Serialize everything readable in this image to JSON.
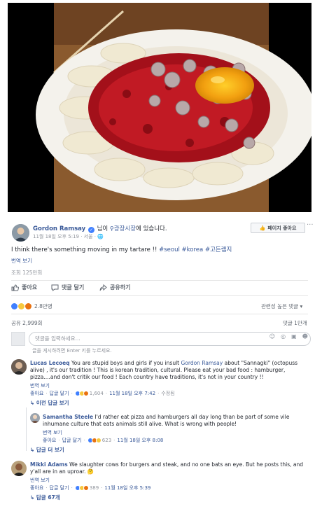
{
  "post": {
    "author": "Gordon Ramsay",
    "author_suffix": "님이",
    "location": "광장시장",
    "location_suffix": "에 있습니다.",
    "meta": "11월 18일 오후 5:19 · 서울 ·",
    "like_page_label": "페이지 좋아요",
    "more_label": "···",
    "caption_text": "I think there's something moving in my tartare !! ",
    "caption_tags": "#seoul #korea #고든램지",
    "see_translation": "번역 보기",
    "views": "조회 125만회"
  },
  "actions": {
    "like": "좋아요",
    "comment": "댓글 달기",
    "share": "공유하기"
  },
  "stats": {
    "reactions": "2.8만명",
    "ranking": "관련성 높은 댓글 ▾",
    "shares": "공유 2,999회",
    "comment_count": "댓글 1만개"
  },
  "composer": {
    "placeholder": "댓글을 입력하세요...",
    "hint": "글을 게시하려면 Enter 키를 누르세요."
  },
  "comments": [
    {
      "author": "Lucas Lecoeq",
      "text_before": " You are stupid boys and girls if you insult ",
      "mention": "Gordon Ramsay",
      "text_after": " about \"Sannagki\" (octopuss alive) , it's our tradition ! This is korean tradition, cultural. Please eat your bad food : hamburger, pizza....and don't critik our food ! Each country have traditions, it's not in your country !!",
      "translate": "번역 보기",
      "like": "좋아요",
      "reply": "답글 달기",
      "reaction_count": "1,604",
      "time": "11월 18일 오후 7:42",
      "edited": "수정됨",
      "prev_replies": "이전 답글 보기"
    },
    {
      "author": "Samantha Steele",
      "text": " I'd rather eat pizza and hamburgers all day long than be part of some vile inhumane culture that eats animals still alive. What is wrong with people!",
      "translate": "번역 보기",
      "like": "좋아요",
      "reply": "답글 달기",
      "reaction_count": "623",
      "time": "11월 18일 오후 8:08",
      "more_replies": "답글 더 보기"
    },
    {
      "author": "Mikki Adams",
      "text": " We slaughter cows for burgers and steak, and no one bats an eye. But he posts this, and y'all are in an uproar. 🤔",
      "translate": "번역 보기",
      "like": "좋아요",
      "reply": "답글 달기",
      "reaction_count": "389",
      "time": "11월 18일 오후 5:39",
      "replies": "답글 67개"
    }
  ],
  "colors": {
    "link": "#385898",
    "muted": "#90949c",
    "like_blue": "#4080ff",
    "haha_yellow": "#f7c93f",
    "angry_orange": "#e9710f"
  }
}
